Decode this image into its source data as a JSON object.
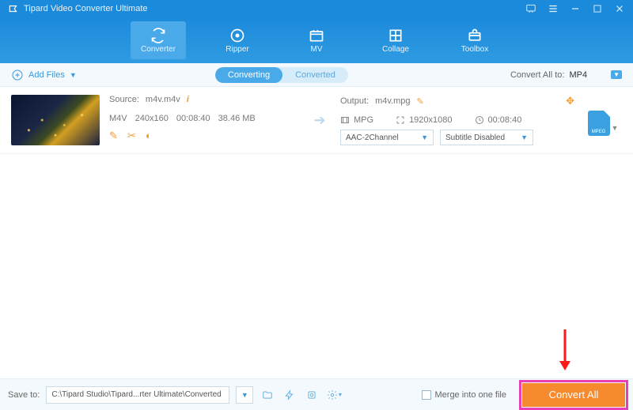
{
  "title": "Tipard Video Converter Ultimate",
  "tabs": {
    "converter": "Converter",
    "ripper": "Ripper",
    "mv": "MV",
    "collage": "Collage",
    "toolbox": "Toolbox"
  },
  "toolbar": {
    "add_files": "Add Files",
    "subtabs": {
      "converting": "Converting",
      "converted": "Converted"
    },
    "convert_all_to_label": "Convert All to:",
    "convert_all_to_value": "MP4"
  },
  "file": {
    "source_label": "Source:",
    "source_name": "m4v.m4v",
    "container": "M4V",
    "resolution": "240x160",
    "duration": "00:08:40",
    "size": "38.46 MB",
    "output_label": "Output:",
    "output_name": "m4v.mpg",
    "out_container": "MPG",
    "out_resolution": "1920x1080",
    "out_duration": "00:08:40",
    "audio_select": "AAC-2Channel",
    "subtitle_select": "Subtitle Disabled",
    "format_badge": "MPEG"
  },
  "bottom": {
    "save_to_label": "Save to:",
    "save_path": "C:\\Tipard Studio\\Tipard...rter Ultimate\\Converted",
    "merge_label": "Merge into one file",
    "convert_all": "Convert All"
  }
}
